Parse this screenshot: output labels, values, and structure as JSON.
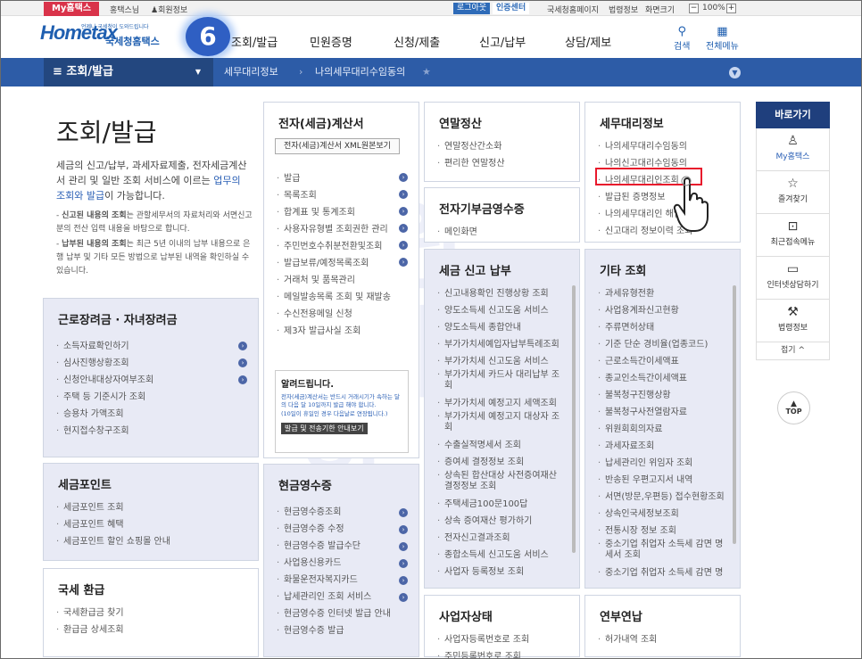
{
  "topbar": {
    "my_tab": "My홈택스",
    "user": "홍택스님",
    "user_info": "회원정보",
    "logout": "로그아웃",
    "cert": "인증센터",
    "links": [
      "국세청홈페이지",
      "법령정보",
      "화면크기"
    ],
    "zoom": "100%"
  },
  "header": {
    "logo": "Hometax",
    "logo_sub": "국세청홈택스",
    "logo_tiny": "언제나 국세청이 도와드립니다",
    "badge": "6",
    "menus": [
      "조회/발급",
      "민원증명",
      "신청/제출",
      "신고/납부",
      "상담/제보"
    ],
    "search": "검색",
    "all_menu": "전체메뉴"
  },
  "nav": {
    "title": "조회/발급",
    "crumb1": "세무대리정보",
    "crumb2": "나의세무대리수임동의"
  },
  "watermark": [
    "아",
    "원",
    "세",
    "회"
  ],
  "page": {
    "title": "조회/발급",
    "desc_pre": "세금의 신고/납부, 과세자료제출, 전자세금계산서 관리 및 일반 조회 서비스에 이르는 ",
    "desc_link": "업무의 조회와 발급",
    "desc_post": "이 가능합니다.",
    "note1_b": "신고된 내용의 조회",
    "note1": "는 관할세무서의 자료처리와 서면신고분의 전산 입력 내용을 바탕으로 합니다.",
    "note2_b": "납부된 내용의 조회",
    "note2": "는 최근 5년 이내의 납부 내용으로 은행 납부 및 기타 모든 방법으로 납부된 내역을 확인하실 수 있습니다."
  },
  "boxes": {
    "earned": {
      "title": "근로장려금 · 자녀장려금",
      "items": [
        "소득자료확인하기",
        "심사진행상황조회",
        "신청안내대상자여부조회",
        "주택 등 기준시가 조회",
        "승용차 가액조회",
        "현지접수창구조회"
      ]
    },
    "taxpoint": {
      "title": "세금포인트",
      "items": [
        "세금포인트 조회",
        "세금포인트 혜택",
        "세금포인트 할인 쇼핑몰 안내"
      ]
    },
    "refund": {
      "title": "국세 환급",
      "items": [
        "국세환급금 찾기",
        "환급금 상세조회"
      ]
    },
    "einvoice": {
      "title": "전자(세금)계산서",
      "sub_btn": "전자(세금)계산서 XML원본보기",
      "items": [
        "발급",
        "목록조회",
        "합계표 및 통계조회",
        "사용자유형별 조회권한 관리",
        "주민번호수취분전환및조회",
        "발급보류/예정목록조회",
        "거래처 및 품목관리",
        "메일발송목록 조회 및 재발송",
        "수신전용메일 신청",
        "제3자 발급사실 조회"
      ]
    },
    "notice": {
      "title": "알려드립니다.",
      "text1": "전자(세금)계산서는 반드시 거래시기가 속하는 달의 다음 달 10일까지 발급 해야 합니다.",
      "text2": "(10일이 휴일인 경우 다음날로 연장됩니다.)",
      "btn": "발급 및 전송기한 안내보기"
    },
    "cash": {
      "title": "현금영수증",
      "items": [
        "현금영수증조회",
        "현금영수증 수정",
        "현금영수증 발급수단",
        "사업용신용카드",
        "화물운전자복지카드",
        "납세관리인 조회 서비스",
        "현금영수증 인터넷 발급 안내",
        "현금영수증 발급"
      ]
    },
    "yearend": {
      "title": "연말정산",
      "items": [
        "연말정산간소화",
        "편리한 연말정산"
      ]
    },
    "donation": {
      "title": "전자기부금영수증",
      "items": [
        "메인화면"
      ]
    },
    "taxreport": {
      "title": "세금 신고 납부",
      "items": [
        "신고내용확인 진행상황 조회",
        "양도소득세 신고도움 서비스",
        "양도소득세 종합안내",
        "부가가치세예입자납부특례조회",
        "부가가치세 신고도움 서비스",
        "부가가치세 카드사 대리납부 조회",
        "부가가치세 예정고지 세액조회",
        "부가가치세 예정고지 대상자 조회",
        "수출실적명세서 조회",
        "증여세 결정정보 조회",
        "상속된 합산대상 사전증여재산 결정정보 조회",
        "주택세금100문100답",
        "상속 증여재산 평가하기",
        "전자신고결과조회",
        "종합소득세 신고도움 서비스",
        "사업자 등록정보 조회"
      ]
    },
    "bizstatus": {
      "title": "사업자상태",
      "items": [
        "사업자등록번호로 조회",
        "주민등록번호로 조회"
      ]
    },
    "agent": {
      "title": "세무대리정보",
      "items": [
        "나의세무대리수임동의",
        "나의신고대리수임동의",
        "나의세무대리인조회",
        "발급된 증명정보",
        "나의세무대리인 해임",
        "신고대리 정보이력 조회"
      ]
    },
    "etc": {
      "title": "기타 조회",
      "items": [
        "과세유형전환",
        "사업용계좌신고현황",
        "주류면허상태",
        "기준 단순 경비율(업종코드)",
        "근로소득간이세액표",
        "종교인소득간이세액표",
        "불복청구진행상황",
        "불복청구사전열람자료",
        "위원회회의자료",
        "과세자료조회",
        "납세관리인 위임자 조회",
        "반송된 우편고지서 내역",
        "서면(방문,우편등) 접수현황조회",
        "상속인국세정보조회",
        "전통시장 정보 조회",
        "중소기업 취업자 소득세 감면 명세서 조회",
        "중소기업 취업자 소득세 감면 명"
      ]
    },
    "pension": {
      "title": "연부연납",
      "items": [
        "허가내역 조회"
      ]
    }
  },
  "right": {
    "head": "바로가기",
    "items": [
      {
        "icon": "person-icon",
        "glyph": "♙",
        "label": "My홈택스"
      },
      {
        "icon": "star-icon",
        "glyph": "☆",
        "label": "즐겨찾기"
      },
      {
        "icon": "recent-icon",
        "glyph": "⊡",
        "label": "최근접속메뉴"
      },
      {
        "icon": "monitor-icon",
        "glyph": "▭",
        "label": "인터넷상담하기"
      },
      {
        "icon": "gavel-icon",
        "glyph": "⚒",
        "label": "법령정보"
      }
    ],
    "fold": "접기",
    "top": "TOP"
  }
}
